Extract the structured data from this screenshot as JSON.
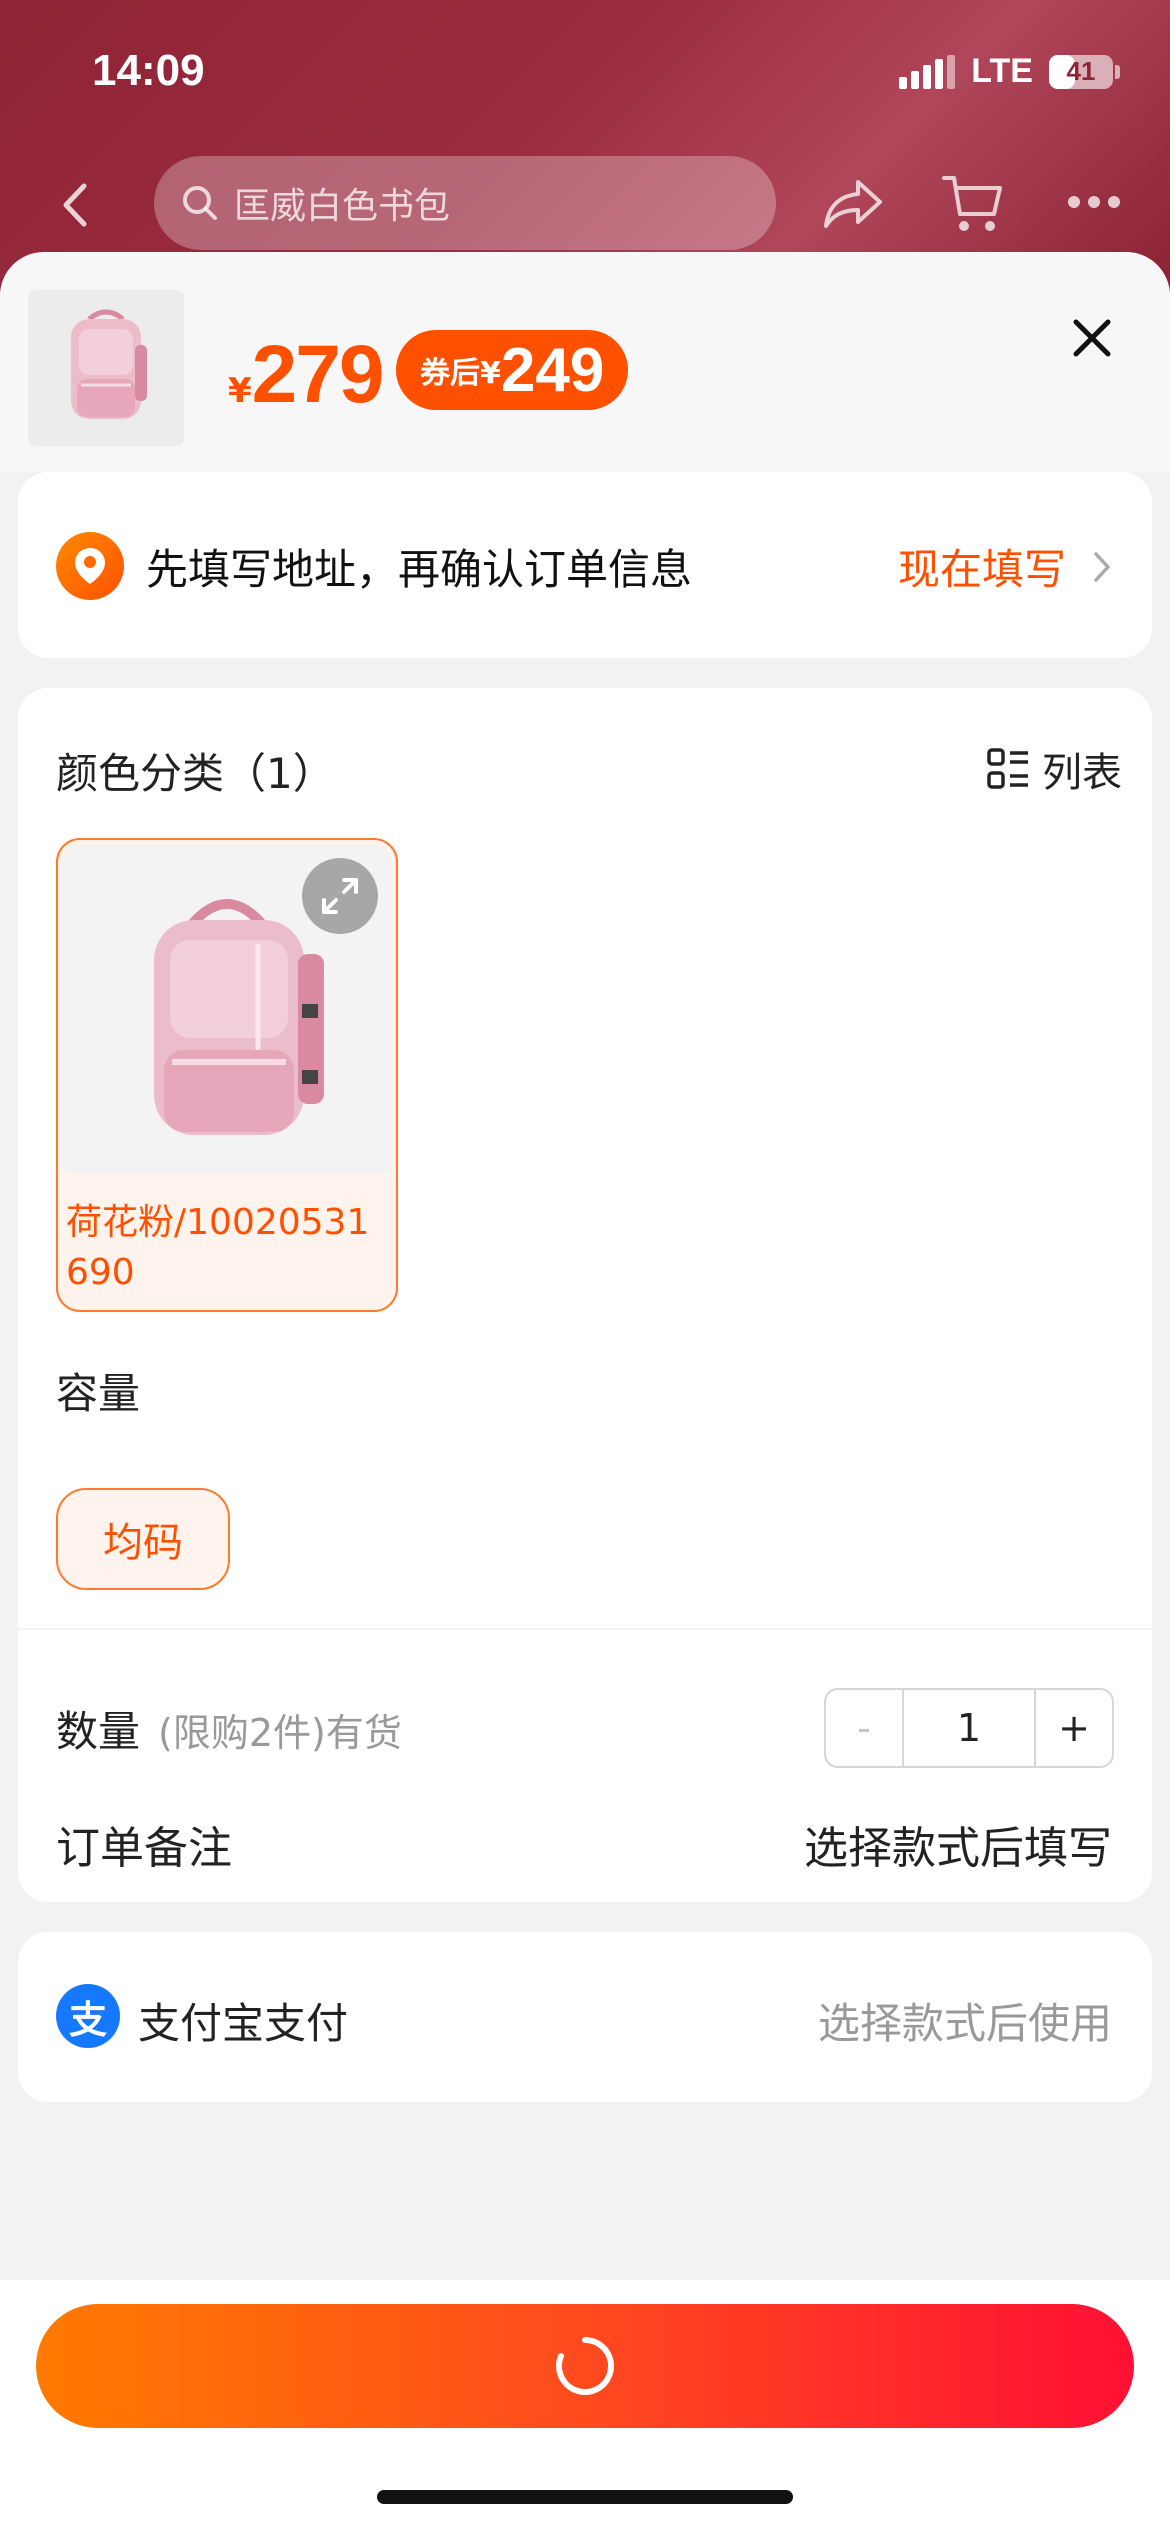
{
  "status_bar": {
    "time": "14:09",
    "network": "LTE",
    "battery": "41",
    "battery_level": 0.41
  },
  "header": {
    "search_text": "匡威白色书包"
  },
  "product": {
    "price_symbol": "¥",
    "price": "279",
    "coupon_label": "券后¥",
    "coupon_price": "249"
  },
  "address": {
    "prompt": "先填写地址，再确认订单信息",
    "action": "现在填写"
  },
  "sku": {
    "color_title": "颜色分类（1）",
    "list_toggle": "列表",
    "variants": [
      {
        "label": "荷花粉/10020531690"
      }
    ],
    "capacity_title": "容量",
    "capacity_option": "均码"
  },
  "quantity": {
    "label": "数量",
    "note": "(限购2件)有货",
    "minus": "-",
    "value": "1",
    "plus": "+"
  },
  "order_note": {
    "label": "订单备注",
    "action": "选择款式后填写"
  },
  "payment": {
    "label": "支付宝支付",
    "icon_text": "支",
    "action": "选择款式后使用"
  },
  "colors": {
    "accent": "#ff5000",
    "header_bg": "#8e2435",
    "alipay": "#1677ff"
  }
}
